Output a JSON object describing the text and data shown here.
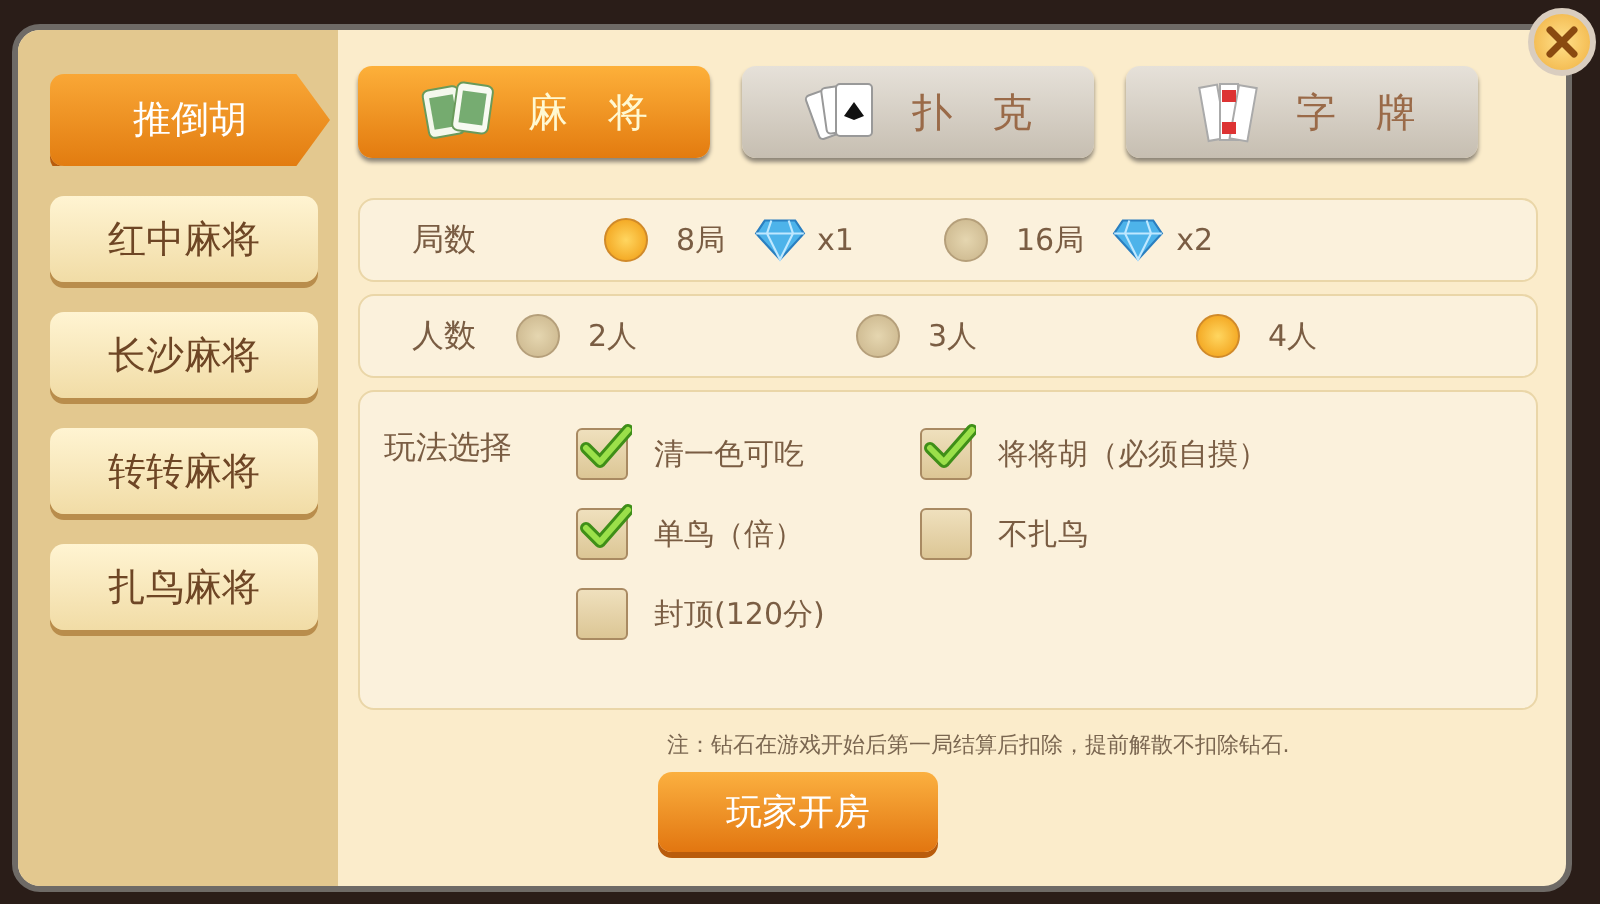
{
  "sidebar": {
    "items": [
      {
        "label": "推倒胡",
        "selected": true
      },
      {
        "label": "红中麻将",
        "selected": false
      },
      {
        "label": "长沙麻将",
        "selected": false
      },
      {
        "label": "转转麻将",
        "selected": false
      },
      {
        "label": "扎鸟麻将",
        "selected": false
      }
    ]
  },
  "tabs": [
    {
      "label": "麻　将",
      "kind": "tiles",
      "selected": true
    },
    {
      "label": "扑　克",
      "kind": "cards",
      "selected": false
    },
    {
      "label": "字　牌",
      "kind": "paper",
      "selected": false
    }
  ],
  "settings": [
    {
      "label": "局数",
      "kind": "radio",
      "options": [
        {
          "label": "8局",
          "cost": "x1",
          "selected": true
        },
        {
          "label": "16局",
          "cost": "x2",
          "selected": false
        }
      ]
    },
    {
      "label": "人数",
      "kind": "radio",
      "options": [
        {
          "label": "2人",
          "selected": false
        },
        {
          "label": "3人",
          "selected": false
        },
        {
          "label": "4人",
          "selected": true
        }
      ]
    },
    {
      "label": "玩法选择",
      "kind": "check",
      "options": [
        {
          "label": "清一色可吃",
          "checked": true
        },
        {
          "label": "将将胡（必须自摸）",
          "checked": true
        },
        {
          "label": "单鸟（倍）",
          "checked": true
        },
        {
          "label": "不扎鸟",
          "checked": false
        },
        {
          "label": "封顶(120分)",
          "checked": false
        }
      ]
    }
  ],
  "note": "注：钻石在游戏开始后第一局结算后扣除，提前解散不扣除钻石.",
  "create_button": "玩家开房"
}
